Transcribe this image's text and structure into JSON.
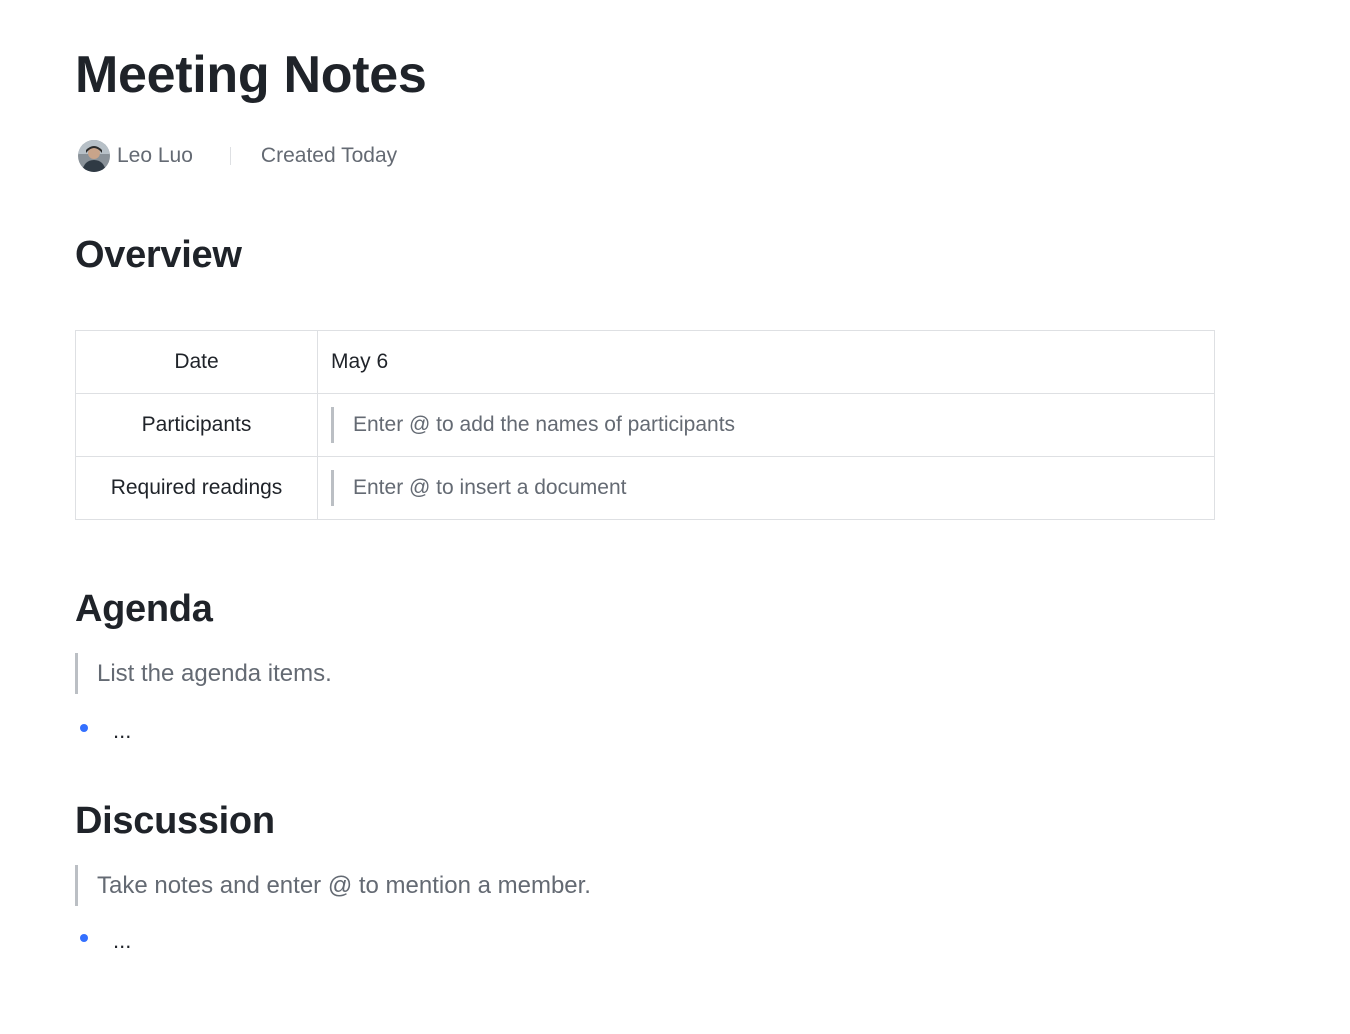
{
  "document": {
    "title": "Meeting Notes"
  },
  "meta": {
    "author": "Leo Luo",
    "created": "Created Today",
    "avatar_icon": "user-avatar"
  },
  "sections": {
    "overview": {
      "heading": "Overview",
      "rows": [
        {
          "label": "Date",
          "value": "May 6"
        },
        {
          "label": "Participants",
          "placeholder": "Enter @ to add the names of participants"
        },
        {
          "label": "Required readings",
          "placeholder": "Enter @ to insert a document"
        }
      ]
    },
    "agenda": {
      "heading": "Agenda",
      "hint": "List the agenda items.",
      "bullet": "..."
    },
    "discussion": {
      "heading": "Discussion",
      "hint": "Take notes and enter @ to mention a member.",
      "bullet": "..."
    }
  },
  "colors": {
    "text": "#1f2329",
    "muted": "#646a73",
    "border": "#dee0e3",
    "quote_bar": "#bbbfc4",
    "bullet": "#3370ff"
  }
}
